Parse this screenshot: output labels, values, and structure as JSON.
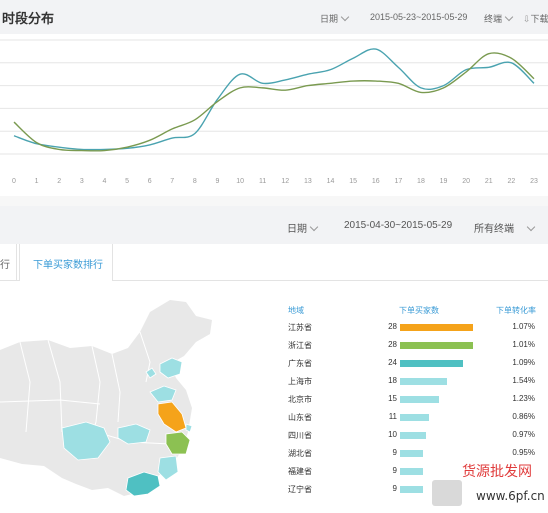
{
  "top_panel": {
    "title": "时段分布",
    "date_label": "日期",
    "date_range": "2015-05-23~2015-05-29",
    "device_filter": "终端",
    "download_label": "下载"
  },
  "chart_data": {
    "type": "line",
    "x": [
      "0",
      "1",
      "2",
      "3",
      "4",
      "5",
      "6",
      "7",
      "8",
      "9",
      "10",
      "11",
      "12",
      "13",
      "14",
      "15",
      "16",
      "17",
      "18",
      "19",
      "20",
      "21",
      "22",
      "23"
    ],
    "xlabel": "",
    "ylabel": "",
    "grid": true,
    "legend": "none",
    "ylim": [
      0,
      100
    ],
    "series": [
      {
        "color": "#4aa3b0",
        "values": [
          16,
          9,
          6,
          4,
          4,
          5,
          8,
          14,
          18,
          48,
          70,
          62,
          65,
          70,
          74,
          84,
          92,
          76,
          58,
          60,
          74,
          76,
          80,
          62
        ]
      },
      {
        "color": "#7a9a50",
        "values": [
          28,
          10,
          4,
          3,
          3,
          6,
          12,
          22,
          30,
          46,
          58,
          58,
          56,
          60,
          62,
          64,
          64,
          62,
          54,
          58,
          72,
          88,
          84,
          66
        ]
      }
    ]
  },
  "filter_bar": {
    "date_label": "日期",
    "date_range": "2015-04-30~2015-05-29",
    "device_filter": "所有终端"
  },
  "tabs": {
    "partial_label": "行",
    "active_label": "下单买家数排行"
  },
  "ranking": {
    "headers": {
      "region": "地域",
      "buyers": "下单买家数",
      "rate": "下单转化率"
    },
    "max_value": 28,
    "rows": [
      {
        "region": "江苏省",
        "buyers": "28",
        "value": 28,
        "rate": "1.07%",
        "color": "#f5a31a"
      },
      {
        "region": "浙江省",
        "buyers": "28",
        "value": 28,
        "rate": "1.01%",
        "color": "#8cc152"
      },
      {
        "region": "广东省",
        "buyers": "24",
        "value": 24,
        "rate": "1.09%",
        "color": "#4fc0c2"
      },
      {
        "region": "上海市",
        "buyers": "18",
        "value": 18,
        "rate": "1.54%",
        "color": "#9ddfe3"
      },
      {
        "region": "北京市",
        "buyers": "15",
        "value": 15,
        "rate": "1.23%",
        "color": "#9ddfe3"
      },
      {
        "region": "山东省",
        "buyers": "11",
        "value": 11,
        "rate": "0.86%",
        "color": "#9ddfe3"
      },
      {
        "region": "四川省",
        "buyers": "10",
        "value": 10,
        "rate": "0.97%",
        "color": "#9ddfe3"
      },
      {
        "region": "湖北省",
        "buyers": "9",
        "value": 9,
        "rate": "0.95%",
        "color": "#9ddfe3"
      },
      {
        "region": "福建省",
        "buyers": "9",
        "value": 9,
        "rate": "",
        "color": "#9ddfe3"
      },
      {
        "region": "辽宁省",
        "buyers": "9",
        "value": 9,
        "rate": "",
        "color": "#9ddfe3"
      }
    ]
  },
  "map": {
    "base_color": "#e8e8e8",
    "jiangsu_color": "#f5a31a",
    "zhejiang_color": "#8cc152",
    "guangdong_color": "#4fc0c2",
    "light_color": "#9ddfe3"
  },
  "watermark": {
    "text": "货源批发网",
    "url": "www.6pf.cn"
  }
}
